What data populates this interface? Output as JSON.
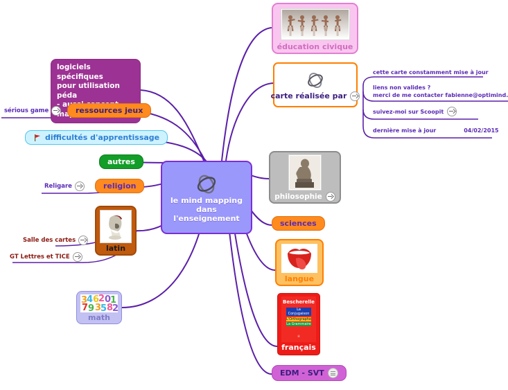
{
  "central": {
    "label": "le mind mapping dans l'enseignement",
    "icon": "orbit-icon",
    "fill": "#9a98fb",
    "border": "#7b2fd4"
  },
  "branch_color": "#5b1fa8",
  "nodes": {
    "education_civique": {
      "label": "éducation civique",
      "fill": "#f9c6ef",
      "border": "#e27fd2",
      "icon": "people-crowd-image"
    },
    "carte_realisee": {
      "label": "carte réalisée par",
      "fill": "#ffffff",
      "border": "#ff7e00",
      "icon": "orbit-icon",
      "link_icon": "arrow-link-icon"
    },
    "philosophie": {
      "label": "philosophie",
      "fill": "#bdbdbd",
      "border": "#8c8c8c",
      "icon": "thinker-statue-image",
      "link_icon": "arrow-link-icon"
    },
    "sciences": {
      "label": "sciences",
      "fill": "#ff8a1e",
      "border": "#e07010"
    },
    "langue": {
      "label": "langue",
      "fill": "#fdc162",
      "border": "#ff7e00",
      "icon": "tongue-mouth-image"
    },
    "francais": {
      "label": "français",
      "fill": "#ee1c18",
      "border": "#cc1510",
      "icon": "bescherelle-book-image",
      "book": {
        "title": "Bescherelle",
        "lines": [
          "La Conjugaison",
          "L'Orthographe",
          "La Grammaire"
        ]
      }
    },
    "edm_svt": {
      "label": "EDM - SVT",
      "fill": "#d162d6",
      "border": "#b246b8",
      "icon": "note-list-icon"
    },
    "logiciels": {
      "label": "logiciels spécifiques\npour utilisation péda\n- aussi concept map",
      "fill": "#9c3293",
      "border": "#8a2b82"
    },
    "ressources_jeux": {
      "label": "ressources jeux",
      "fill": "#ff8a1e",
      "border": "#e07010"
    },
    "difficultes": {
      "label": "difficultés d'apprentissage",
      "fill": "#cef3ff",
      "border": "#4fc3f0",
      "icon": "red-flag-icon"
    },
    "autres": {
      "label": "autres",
      "fill": "#129e28",
      "border": "#0d7d1f"
    },
    "religion": {
      "label": "religion",
      "fill": "#ff8a1e",
      "border": "#e07010"
    },
    "latin": {
      "label": "latin",
      "fill": "#c05a0c",
      "border": "#a04a08",
      "icon": "roman-helmet-image"
    },
    "math": {
      "label": "math",
      "fill": "#c3c1f2",
      "border": "#8f8ce0",
      "icon": "colored-numbers-image"
    }
  },
  "left_links": [
    {
      "label": "sérious game",
      "icon": "arrow-link-icon"
    },
    {
      "label": "Religare",
      "icon": "arrow-link-icon"
    },
    {
      "label": "Salle des cartes",
      "icon": "arrow-link-icon"
    },
    {
      "label": "GT Lettres et TICE",
      "icon": "arrow-link-icon"
    }
  ],
  "right_notes": {
    "constamment": "cette carte constamment mise à jour",
    "liens_line1": "liens non valides ?",
    "liens_line2": "merci de me contacter fabienne@optimind.be",
    "scoopit": "suivez-moi sur Scoopit",
    "maj_label": "dernière mise à jour",
    "maj_date": "04/02/2015"
  }
}
